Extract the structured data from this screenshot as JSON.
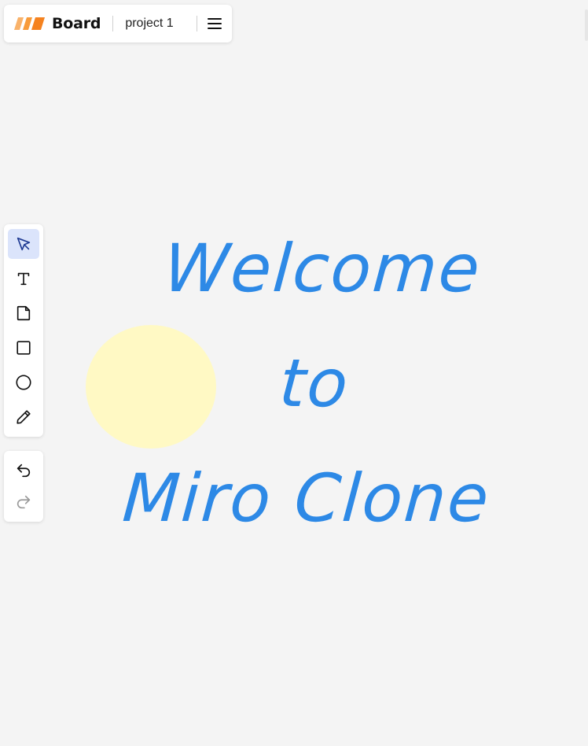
{
  "header": {
    "app_name": "Board",
    "project_name": "project 1",
    "logo_icon": "stripes-logo-icon",
    "menu_icon": "hamburger-menu-icon"
  },
  "toolbar": {
    "tools": [
      {
        "name": "select",
        "icon": "cursor-arrow-icon",
        "active": true
      },
      {
        "name": "text",
        "icon": "text-icon",
        "active": false
      },
      {
        "name": "sticky-note",
        "icon": "sticky-note-icon",
        "active": false
      },
      {
        "name": "rectangle",
        "icon": "square-icon",
        "active": false
      },
      {
        "name": "ellipse",
        "icon": "circle-icon",
        "active": false
      },
      {
        "name": "pen",
        "icon": "pencil-icon",
        "active": false
      }
    ],
    "history": [
      {
        "name": "undo",
        "icon": "undo-icon",
        "enabled": true
      },
      {
        "name": "redo",
        "icon": "redo-icon",
        "enabled": false
      }
    ]
  },
  "board": {
    "text": "Welcome to\nMiro Clone",
    "text_color": "#2d89e6",
    "circle_color": "#fff9c4"
  },
  "colors": {
    "background": "#f4f4f4",
    "logo_orange": "#f5821f",
    "active_tool_bg": "#dbe4fb"
  }
}
